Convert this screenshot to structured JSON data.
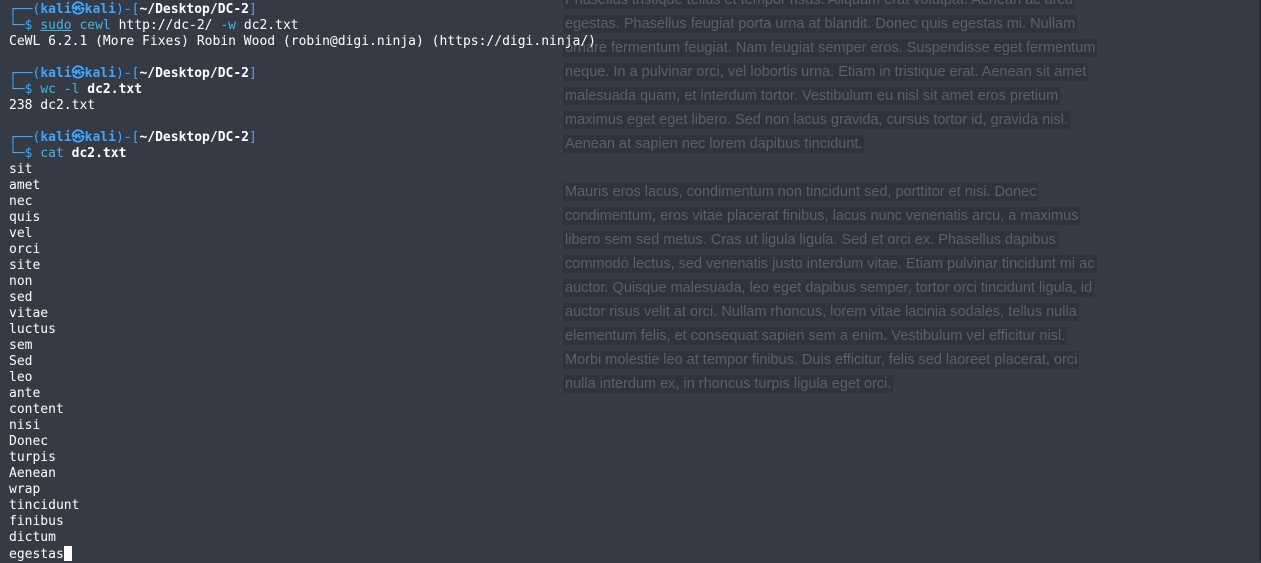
{
  "background_paragraphs": [
    "Phasellus tristique tellus et tempor risus. Aliquam erat volutpat. Aenean ac arcu egestas. Phasellus feugiat porta urna at blandit. Donec quis egestas mi. Nullam ornare fermentum feugiat. Nam feugiat semper eros. Suspendisse eget fermentum neque. In a pulvinar orci, vel lobortis urna. Etiam in tristique erat. Aenean sit amet malesuada quam, et interdum tortor. Vestibulum eu nisl sit amet eros pretium maximus eget eget libero. Sed non lacus gravida, cursus tortor id, gravida nisl. Aenean at sapien nec lorem dapibus tincidunt.",
    "Mauris eros lacus, condimentum non tincidunt sed, porttitor et nisi. Donec condimentum, eros vitae placerat finibus, lacus nunc venenatis arcu, a maximus libero sem sed metus. Cras ut ligula ligula. Sed et orci ex. Phasellus dapibus commodo lectus, sed venenatis justo interdum vitae. Etiam pulvinar tincidunt mi ac auctor. Quisque malesuada, leo eget dapibus semper, tortor orci tincidunt ligula, id auctor risus velit at orci. Nullam rhoncus, lorem vitae lacinia sodales, tellus nulla elementum felis, et consequat sapien sem a enim. Vestibulum vel efficitur nisl. Morbi molestie leo at tempor finibus. Duis efficitur, felis sed laoreet placerat, orci nulla interdum ex, in rhoncus turpis ligula eget orci."
  ],
  "prompt": {
    "top_prefix": "┌──(",
    "user": "kali",
    "at": "㉿",
    "host": "kali",
    "mid": ")-[",
    "path": "~/Desktop/DC-2",
    "close": "]",
    "bottom_prefix": "└─",
    "dollar": "$ "
  },
  "commands": [
    {
      "tokens": [
        {
          "text": "sudo",
          "style": "cmd ul"
        },
        {
          "text": " ",
          "style": ""
        },
        {
          "text": "cewl",
          "style": "cmd"
        },
        {
          "text": " http://dc-2/ ",
          "style": ""
        },
        {
          "text": "-w",
          "style": "flag"
        },
        {
          "text": " dc2.txt",
          "style": ""
        }
      ],
      "output": [
        "CeWL 6.2.1 (More Fixes) Robin Wood (robin@digi.ninja) (https://digi.ninja/)"
      ]
    },
    {
      "tokens": [
        {
          "text": "wc",
          "style": "cmd"
        },
        {
          "text": " ",
          "style": ""
        },
        {
          "text": "-l",
          "style": "flag"
        },
        {
          "text": " ",
          "style": ""
        },
        {
          "text": "dc2.txt",
          "style": "argb"
        }
      ],
      "output": [
        "238 dc2.txt"
      ]
    },
    {
      "tokens": [
        {
          "text": "cat",
          "style": "cmd"
        },
        {
          "text": " ",
          "style": ""
        },
        {
          "text": "dc2.txt",
          "style": "argb"
        }
      ],
      "output": [
        "sit",
        "amet",
        "nec",
        "quis",
        "vel",
        "orci",
        "site",
        "non",
        "sed",
        "vitae",
        "luctus",
        "sem",
        "Sed",
        "leo",
        "ante",
        "content",
        "nisi",
        "Donec",
        "turpis",
        "Aenean",
        "wrap",
        "tincidunt",
        "finibus",
        "dictum",
        "egestas"
      ]
    }
  ]
}
